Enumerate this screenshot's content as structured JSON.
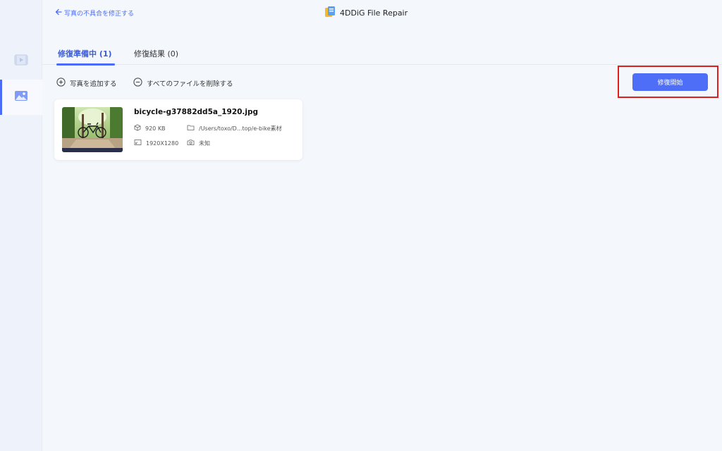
{
  "header": {
    "back_label": "写真の不具合を修正する",
    "app_title": "4DDiG File Repair"
  },
  "sidebar": {
    "items": [
      {
        "icon": "video-icon"
      },
      {
        "icon": "photo-icon",
        "active": true
      }
    ]
  },
  "tabs": [
    {
      "label": "修復準備中 (1)",
      "active": true
    },
    {
      "label": "修復結果 (0)",
      "active": false
    }
  ],
  "toolbar": {
    "add_label": "写真を追加する",
    "remove_all_label": "すべてのファイルを削除する",
    "start_label": "修復開始"
  },
  "files": [
    {
      "name": "bicycle-g37882dd5a_1920.jpg",
      "size": "920 KB",
      "path": "/Users/toxo/D...top/e-bike素材",
      "resolution": "1920X1280",
      "camera": "未知"
    }
  ],
  "colors": {
    "accent": "#4a6cf7",
    "highlight": "#e01e1e",
    "background": "#f4f7fc"
  }
}
